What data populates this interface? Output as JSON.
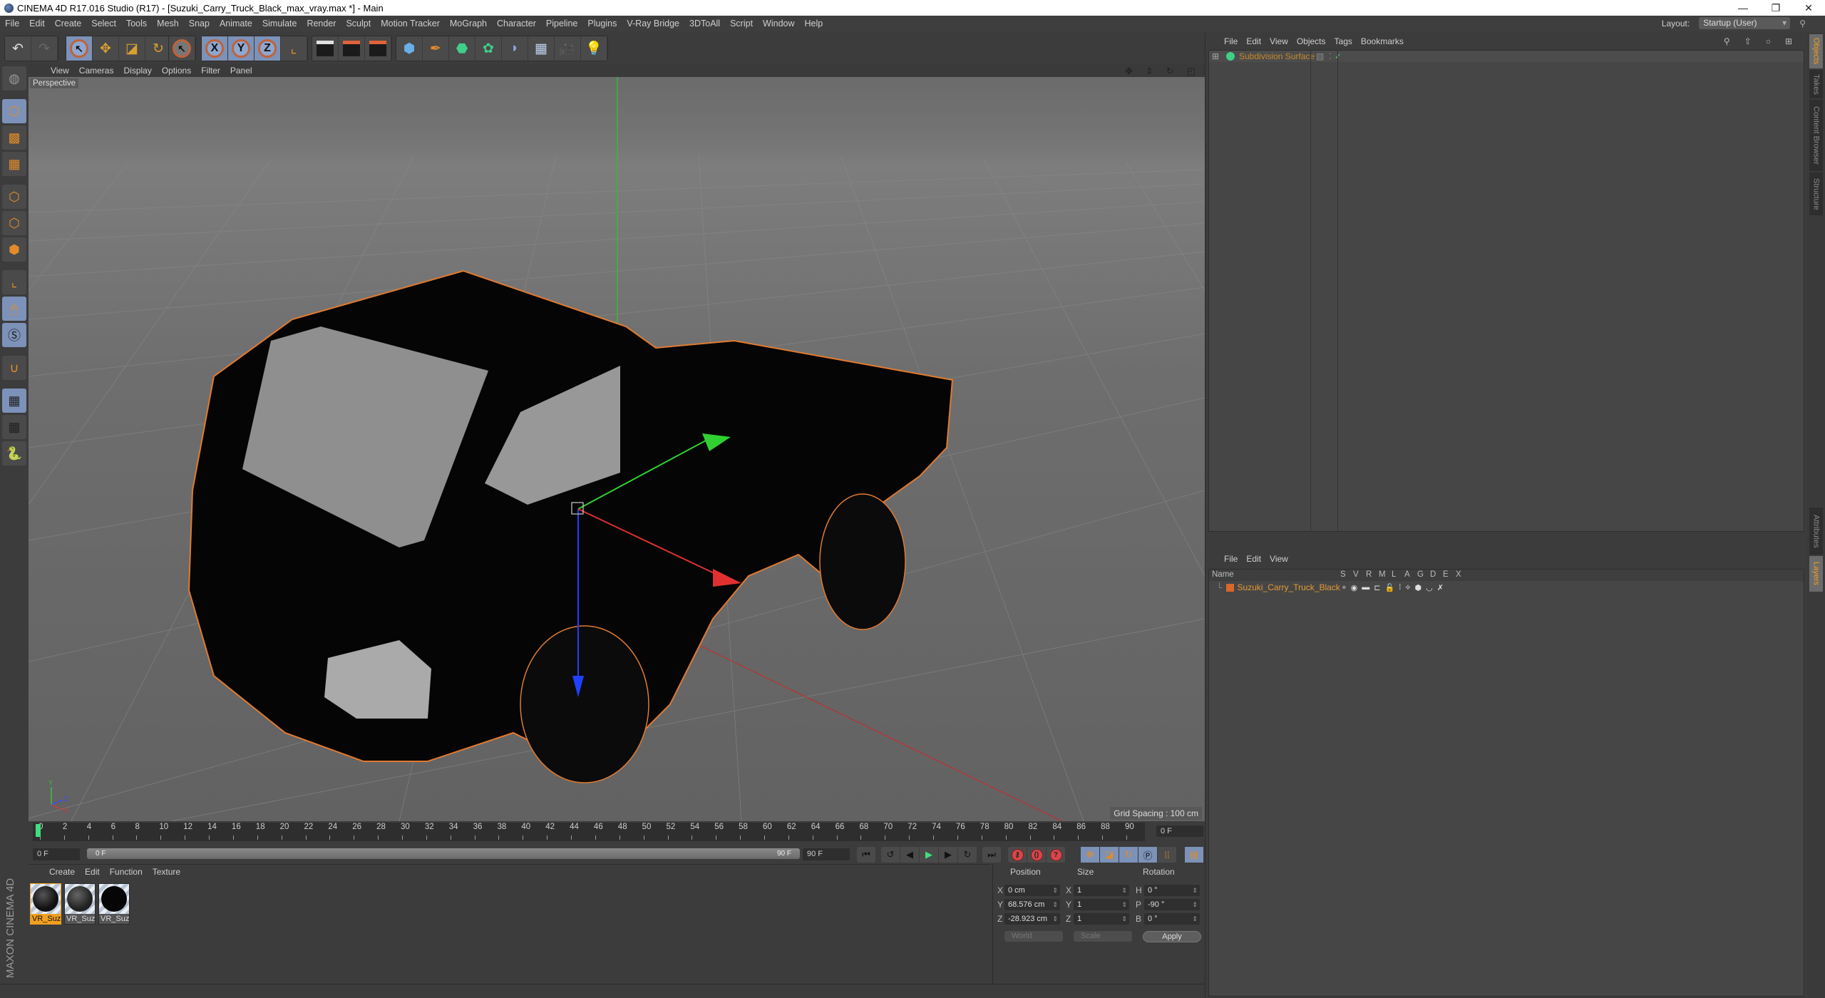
{
  "window": {
    "title": "CINEMA 4D R17.016 Studio (R17) - [Suzuki_Carry_Truck_Black_max_vray.max *] - Main",
    "controls": [
      "minimize",
      "restore",
      "close"
    ]
  },
  "menubar": {
    "items": [
      "File",
      "Edit",
      "Create",
      "Select",
      "Tools",
      "Mesh",
      "Snap",
      "Animate",
      "Simulate",
      "Render",
      "Sculpt",
      "Motion Tracker",
      "MoGraph",
      "Character",
      "Pipeline",
      "Plugins",
      "V-Ray Bridge",
      "3DToAll",
      "Script",
      "Window",
      "Help"
    ],
    "layout_label": "Layout:",
    "layout_value": "Startup (User)"
  },
  "toolbar": {
    "groups": [
      [
        "undo-icon",
        "redo-icon"
      ],
      [
        "live-selection-icon",
        "move-icon",
        "scale-icon",
        "rotate-icon"
      ],
      [
        "last-tool-icon"
      ],
      [
        "x-axis-lock-icon",
        "y-axis-lock-icon",
        "z-axis-lock-icon",
        "coordinate-system-icon"
      ],
      [
        "render-view-icon",
        "render-picture-viewer-icon",
        "render-settings-icon"
      ],
      [
        "cube-icon",
        "pen-spline-icon",
        "subdivision-surface-icon",
        "array-icon",
        "deformer-icon",
        "floor-icon",
        "camera-icon",
        "light-icon"
      ]
    ],
    "axis_labels": [
      "X",
      "Y",
      "Z"
    ]
  },
  "left_toolbar": {
    "items": [
      "make-editable-icon",
      "model-mode-icon",
      "texture-mode-icon",
      "workplane-mode-icon",
      "points-mode-icon",
      "edges-mode-icon",
      "polygons-mode-icon",
      "axis-mode-icon",
      "tweak-mode-icon",
      "solo-icon",
      "snap-icon",
      "workplane-lock-icon",
      "workplane-align-icon",
      "python-icon"
    ]
  },
  "viewport": {
    "menu": [
      "View",
      "Cameras",
      "Display",
      "Options",
      "Filter",
      "Panel"
    ],
    "camera_label": "Perspective",
    "grid_spacing": "Grid Spacing : 100 cm",
    "nav_icons": [
      "pan-icon",
      "dolly-icon",
      "orbit-icon",
      "maximize-view-icon"
    ],
    "axis_gizmo": {
      "x": "X",
      "y": "Y",
      "z": "Z"
    },
    "selection_outline_color": "#e07a30"
  },
  "timeline": {
    "ticks": [
      0,
      2,
      4,
      6,
      8,
      10,
      12,
      14,
      16,
      18,
      20,
      22,
      24,
      26,
      28,
      30,
      32,
      34,
      36,
      38,
      40,
      42,
      44,
      46,
      48,
      50,
      52,
      54,
      56,
      58,
      60,
      62,
      64,
      66,
      68,
      70,
      72,
      74,
      76,
      78,
      80,
      82,
      84,
      86,
      88,
      90
    ],
    "current_frame": "0 F",
    "start_field": "0 F",
    "slider_start": "0 F",
    "slider_end": "90 F",
    "end_field": "90 F",
    "playback_buttons": [
      "go-to-start-icon",
      "previous-key-icon",
      "previous-frame-icon",
      "play-icon",
      "next-frame-icon",
      "next-key-icon",
      "go-to-end-icon"
    ],
    "record_buttons": [
      "record-active-icon",
      "autokeying-icon",
      "keyframe-selection-icon"
    ],
    "key_buttons": [
      "key-position-icon",
      "key-scale-icon",
      "key-rotation-icon",
      "key-parameter-icon",
      "key-pla-icon"
    ],
    "timeline_button": "timeline-window-icon"
  },
  "materials": {
    "menu": [
      "Create",
      "Edit",
      "Function",
      "Texture"
    ],
    "items": [
      {
        "label": "VR_Suzu",
        "selected": true,
        "ball": "#1a1a1a"
      },
      {
        "label": "VR_Suzu",
        "selected": false,
        "ball": "#2a2a2a"
      },
      {
        "label": "VR_Suzu",
        "selected": false,
        "ball": "#050505"
      }
    ]
  },
  "branding": "MAXON CINEMA 4D",
  "coordinates": {
    "headers": {
      "position": "Position",
      "size": "Size",
      "rotation": "Rotation"
    },
    "rows": [
      {
        "pos_axis": "X",
        "pos": "0 cm",
        "size_axis": "X",
        "size": "1",
        "rot_axis": "H",
        "rot": "0 °"
      },
      {
        "pos_axis": "Y",
        "pos": "68.576 cm",
        "size_axis": "Y",
        "size": "1",
        "rot_axis": "P",
        "rot": "-90 °"
      },
      {
        "pos_axis": "Z",
        "pos": "-28.923 cm",
        "size_axis": "Z",
        "size": "1",
        "rot_axis": "B",
        "rot": "0 °"
      }
    ],
    "coord_system": "World",
    "size_mode": "Scale",
    "apply_label": "Apply"
  },
  "object_manager": {
    "menu": [
      "File",
      "Edit",
      "View",
      "Objects",
      "Tags",
      "Bookmarks"
    ],
    "objects": [
      {
        "name": "Subdivision Surface",
        "icon": "subdivision-surface-icon",
        "color": "#c8882a"
      }
    ]
  },
  "layer_manager": {
    "menu": [
      "File",
      "Edit",
      "View"
    ],
    "columns": [
      "Name",
      "S",
      "V",
      "R",
      "M",
      "L",
      "A",
      "G",
      "D",
      "E",
      "X"
    ],
    "layers": [
      {
        "name": "Suzuki_Carry_Truck_Black",
        "color": "#d9662a"
      }
    ]
  },
  "side_tabs": {
    "top": [
      {
        "label": "Objects",
        "active": true
      },
      {
        "label": "Takes",
        "active": false
      },
      {
        "label": "Content Browser",
        "active": false
      },
      {
        "label": "Structure",
        "active": false
      }
    ],
    "bottom": [
      {
        "label": "Attributes",
        "active": false
      },
      {
        "label": "Layers",
        "active": true
      }
    ]
  }
}
